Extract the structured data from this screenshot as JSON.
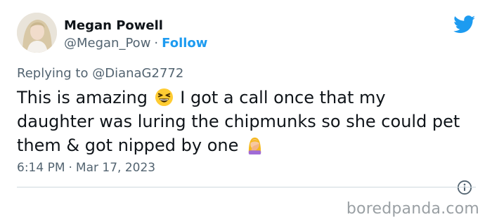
{
  "tweet": {
    "author_name": "Megan Powell",
    "author_handle": "@Megan_Pow",
    "separator": "·",
    "follow_label": "Follow",
    "replying_prefix": "Replying to",
    "replying_to": "@DianaG2772",
    "text_part1": "This is amazing",
    "text_part2": "I got a call once that my daughter was luring the chipmunks so she could pet them & got nipped by one",
    "time": "6:14 PM",
    "date": "Mar 17, 2023",
    "brand_color": "#1d9bf0"
  },
  "icons": {
    "platform": "twitter-bird-icon",
    "emoji_1": "grinning-squinting-face-emoji",
    "emoji_2": "woman-facepalming-emoji",
    "info": "info-circle-icon"
  },
  "watermark": "boredpanda.com"
}
